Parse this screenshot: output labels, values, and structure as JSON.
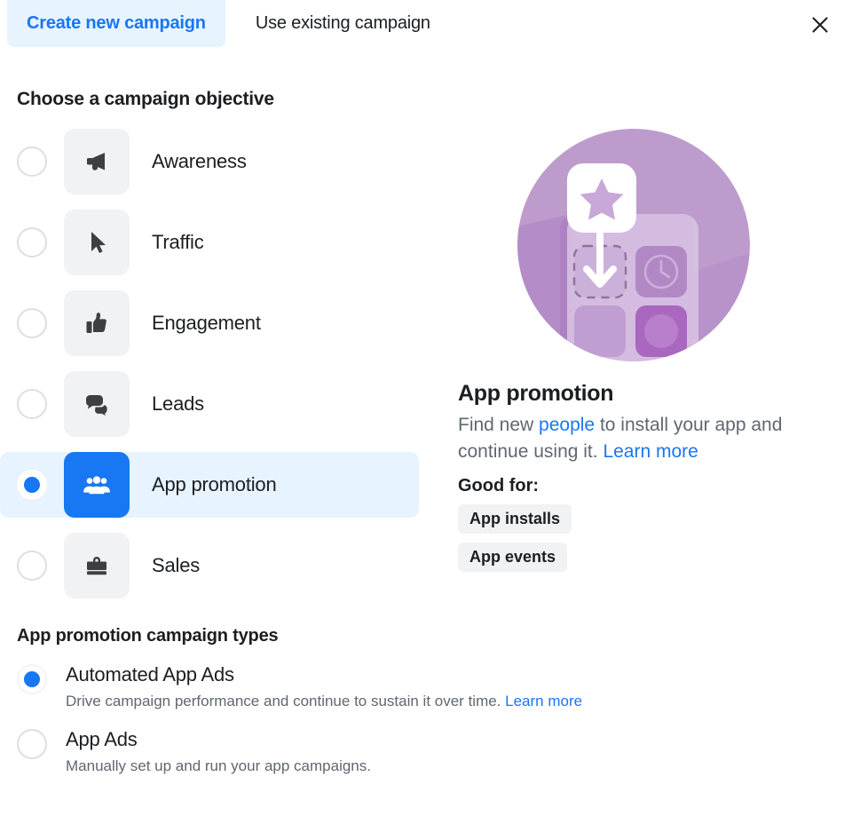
{
  "header": {
    "tabs": [
      {
        "label": "Create new campaign",
        "active": true
      },
      {
        "label": "Use existing campaign",
        "active": false
      }
    ],
    "close_icon": "close-icon"
  },
  "objectives_section": {
    "title": "Choose a campaign objective",
    "items": [
      {
        "label": "Awareness",
        "icon": "megaphone-icon",
        "selected": false
      },
      {
        "label": "Traffic",
        "icon": "cursor-icon",
        "selected": false
      },
      {
        "label": "Engagement",
        "icon": "thumbs-up-icon",
        "selected": false
      },
      {
        "label": "Leads",
        "icon": "speech-bubbles-icon",
        "selected": false
      },
      {
        "label": "App promotion",
        "icon": "people-group-icon",
        "selected": true
      },
      {
        "label": "Sales",
        "icon": "shopping-bag-icon",
        "selected": false
      }
    ]
  },
  "detail": {
    "illustration": "app-install-illustration",
    "title": "App promotion",
    "description_part1": "Find new ",
    "description_link1": "people",
    "description_part2": " to install your app and continue using it. ",
    "description_link2": "Learn more",
    "good_for_label": "Good for:",
    "chips": [
      "App installs",
      "App events"
    ]
  },
  "campaign_types": {
    "title": "App promotion campaign types",
    "items": [
      {
        "label": "Automated App Ads",
        "description": "Drive campaign performance and continue to sustain it over time. ",
        "link": "Learn more",
        "selected": true
      },
      {
        "label": "App Ads",
        "description": "Manually set up and run your app campaigns.",
        "link": "",
        "selected": false
      }
    ]
  },
  "colors": {
    "accent_blue": "#1877f2",
    "tab_highlight": "#e7f3ff",
    "tile_grey": "#f1f2f4",
    "text_secondary": "#606770",
    "illustration_purple": "#b18cc4"
  }
}
